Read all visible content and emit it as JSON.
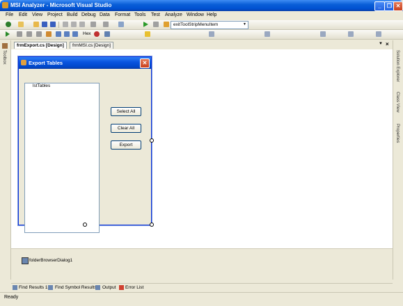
{
  "app": {
    "title": "MSI Analyzer - Microsoft Visual Studio"
  },
  "menu": {
    "items": [
      "File",
      "Edit",
      "View",
      "Project",
      "Build",
      "Debug",
      "Data",
      "Format",
      "Tools",
      "Test",
      "Analyze",
      "Window",
      "Help"
    ]
  },
  "toolbar": {
    "dropdown_value": "exitToolStripMenuItem",
    "hex_label": "Hex"
  },
  "side_panels": {
    "left": "Toolbox",
    "right": [
      "Solution Explorer",
      "Class View",
      "Properties"
    ]
  },
  "doc_tabs": [
    "frmExport.cs [Design]",
    "frmMSI.cs [Design]"
  ],
  "form": {
    "title": "Export Tables",
    "listbox_label": "lstTables",
    "buttons": {
      "select_all": "Select All",
      "clear_all": "Clear All",
      "export": "Export"
    }
  },
  "tray": {
    "component": "folderBrowserDialog1"
  },
  "bottom_tabs": [
    "Find Results 1",
    "Find Symbol Results",
    "Output",
    "Error List"
  ],
  "status": {
    "text": "Ready"
  },
  "colors": {
    "titlebar": "#0a5fd8",
    "close": "#c8401e",
    "form_border": "#0831d9"
  }
}
